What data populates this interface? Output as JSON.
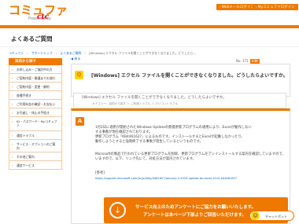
{
  "header": {
    "logo_text": "コミュファ",
    "logo_powered": "Powered by",
    "logo_brand": "ctc",
    "links": [
      "Webメールログイン",
      "Myコミュファログイン"
    ]
  },
  "page_title": "よくあるご質問",
  "breadcrumb": [
    "コミュファ",
    "サポートトップ",
    "よくあるご質問",
    "[Windows] エクセル ファイルを開くことができなくなりました。どうしたら..."
  ],
  "sidebar": {
    "heading": "目的から探す",
    "items": [
      "お申し込み・ご検討中の方",
      "ご契約内容・開通までの流れ",
      "ご契約内容・変更・解約",
      "各種手続き",
      "ご利用料金の確認・お支払い",
      "お引越し・休止の手続き",
      "ID・パスワード・Myコミュファ",
      "通信トラブル",
      "サービス・オプションのご案内",
      "その他ご案内",
      "通信サービス"
    ]
  },
  "main": {
    "back_link": "戻る",
    "meta": "No: 371",
    "meta_pill": "印刷",
    "question_icon": "Q",
    "question_title": "[Windows] エクセル ファイルを開くことができなくなりました。どうしたらよいですか。",
    "question_sub": "[Windows] エクセル ファイルを開くことができなくなりました。どうしたらよいですか。",
    "question_category": "カテゴリー：目的から探す ＞ ご利用トラブル ＞ パソコントラブル",
    "answer_icon": "A",
    "answer_lines": [
      "1月2日に適用が開始されたWindows Updateの無償更新プログラムの適用により、Excelが動作しない",
      "する事象が現在確認されております。",
      "更新プログラム「KB4461627」によるものです。インストールするとExcelが起動しなかったり、",
      "動作しようとすると強制終了する事象が発生しているというものです。",
      "",
      "Microsoftの製品で行われている更新プログラムを削除、更新プログラムをアンインストールする案内を確認していますので、",
      "いますので、以下、リンク先にて、対処方法が案内されています。",
      "",
      "[参考]",
      "https://support.microsoft.com/ja-jp/help/4461627/january-2-2019-update-for-excel-2010-kb4461627"
    ],
    "cta_line1": "サービス向上のためアンケートにご協力をお願いいたします。",
    "cta_line2": "アンケートは本ページ下部よりご回答いただけます。"
  },
  "chatbot": {
    "label": "チャットボット"
  },
  "colors": {
    "brand_orange": "#ee7800",
    "accent_yellow": "#ffd400",
    "ctc_red": "#e60012"
  }
}
